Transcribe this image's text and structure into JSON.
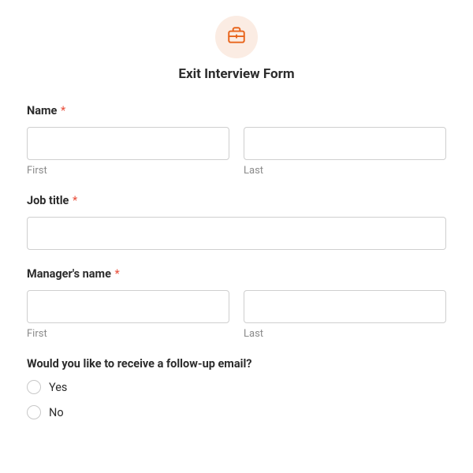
{
  "header": {
    "icon": "briefcase-icon",
    "title": "Exit Interview Form"
  },
  "fields": {
    "name": {
      "label": "Name",
      "required": true,
      "first_sub": "First",
      "last_sub": "Last",
      "first_value": "",
      "last_value": ""
    },
    "job_title": {
      "label": "Job title",
      "required": true,
      "value": ""
    },
    "manager": {
      "label": "Manager's name",
      "required": true,
      "first_sub": "First",
      "last_sub": "Last",
      "first_value": "",
      "last_value": ""
    },
    "followup": {
      "label": "Would you like to receive a follow-up email?",
      "options": [
        "Yes",
        "No"
      ],
      "selected": null
    }
  },
  "required_marker": "*"
}
